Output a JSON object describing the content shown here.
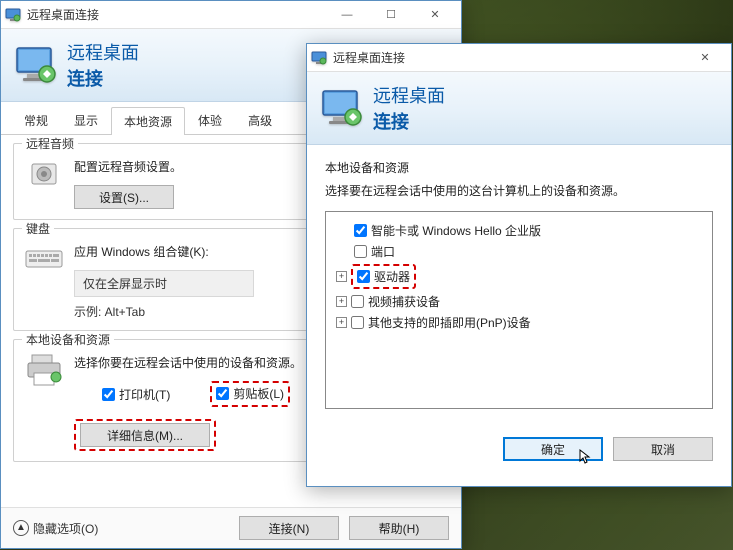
{
  "main": {
    "title": "远程桌面连接",
    "header_main": "远程桌面",
    "header_sub": "连接",
    "tabs": [
      "常规",
      "显示",
      "本地资源",
      "体验",
      "高级"
    ],
    "active_tab": 2,
    "audio": {
      "legend": "远程音频",
      "text": "配置远程音频设置。",
      "button": "设置(S)..."
    },
    "keyboard": {
      "legend": "键盘",
      "text": "应用 Windows 组合键(K):",
      "value": "仅在全屏显示时",
      "example_label": "示例: ",
      "example_value": "Alt+Tab"
    },
    "local": {
      "legend": "本地设备和资源",
      "text": "选择你要在远程会话中使用的设备和资源。",
      "printer_label": "打印机(T)",
      "clipboard_label": "剪贴板(L)",
      "more_button": "详细信息(M)..."
    },
    "footer": {
      "hide_options": "隐藏选项(O)",
      "connect": "连接(N)",
      "help": "帮助(H)"
    }
  },
  "sub": {
    "title": "远程桌面连接",
    "header_main": "远程桌面",
    "header_sub": "连接",
    "section_title": "本地设备和资源",
    "section_desc": "选择要在远程会话中使用的这台计算机上的设备和资源。",
    "items": [
      {
        "label": "智能卡或 Windows Hello 企业版",
        "checked": true,
        "expandable": false
      },
      {
        "label": "端口",
        "checked": false,
        "expandable": false
      },
      {
        "label": "驱动器",
        "checked": true,
        "expandable": true,
        "highlight": true
      },
      {
        "label": "视频捕获设备",
        "checked": false,
        "expandable": true
      },
      {
        "label": "其他支持的即插即用(PnP)设备",
        "checked": false,
        "expandable": true
      }
    ],
    "ok": "确定",
    "cancel": "取消"
  }
}
